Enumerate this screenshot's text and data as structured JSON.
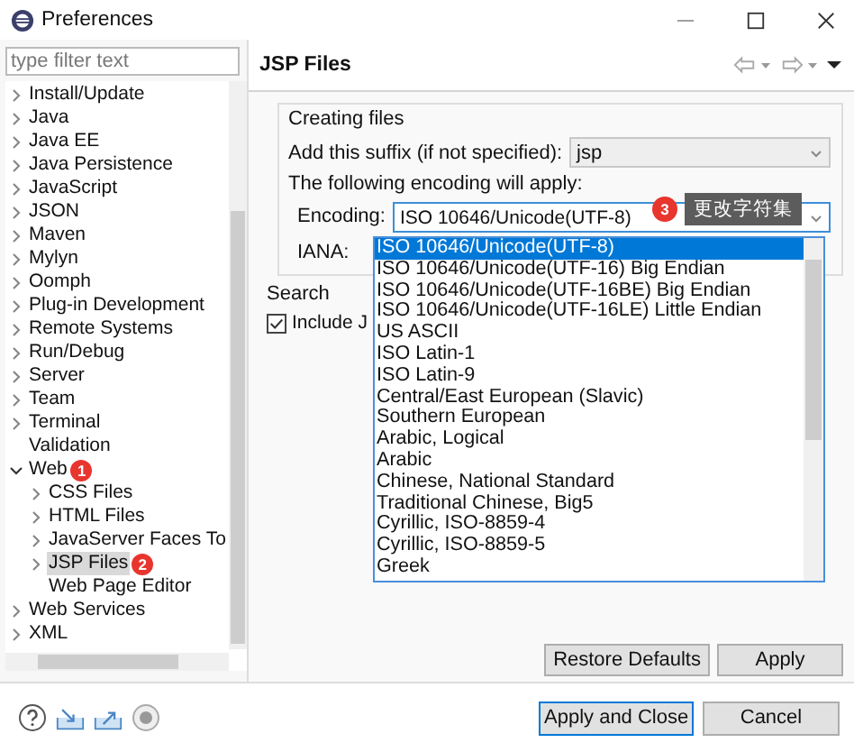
{
  "window": {
    "title": "Preferences"
  },
  "filter": {
    "placeholder": "type filter text"
  },
  "tree": [
    {
      "label": "Install/Update",
      "expanded": false,
      "selected": false
    },
    {
      "label": "Java",
      "expanded": false,
      "selected": false
    },
    {
      "label": "Java EE",
      "expanded": false,
      "selected": false
    },
    {
      "label": "Java Persistence",
      "expanded": false,
      "selected": false
    },
    {
      "label": "JavaScript",
      "expanded": false,
      "selected": false
    },
    {
      "label": "JSON",
      "expanded": false,
      "selected": false
    },
    {
      "label": "Maven",
      "expanded": false,
      "selected": false
    },
    {
      "label": "Mylyn",
      "expanded": false,
      "selected": false
    },
    {
      "label": "Oomph",
      "expanded": false,
      "selected": false
    },
    {
      "label": "Plug-in Development",
      "expanded": false,
      "selected": false
    },
    {
      "label": "Remote Systems",
      "expanded": false,
      "selected": false
    },
    {
      "label": "Run/Debug",
      "expanded": false,
      "selected": false
    },
    {
      "label": "Server",
      "expanded": false,
      "selected": false
    },
    {
      "label": "Team",
      "expanded": false,
      "selected": false
    },
    {
      "label": "Terminal",
      "expanded": false,
      "selected": false
    },
    {
      "label": "Validation",
      "selected": false
    },
    {
      "label": "Web",
      "expanded": true,
      "selected": false,
      "badge": "1",
      "children": [
        {
          "label": "CSS Files",
          "expanded": false,
          "selected": false
        },
        {
          "label": "HTML Files",
          "expanded": false,
          "selected": false
        },
        {
          "label": "JavaServer Faces To",
          "expanded": false,
          "selected": false
        },
        {
          "label": "JSP Files",
          "expanded": false,
          "selected": true,
          "badge": "2"
        },
        {
          "label": "Web Page Editor",
          "selected": false
        }
      ]
    },
    {
      "label": "Web Services",
      "expanded": false,
      "selected": false
    },
    {
      "label": "XML",
      "expanded": false,
      "selected": false
    }
  ],
  "page": {
    "title": "JSP Files",
    "creating_group": {
      "title": "Creating files",
      "suffix_label": "Add this suffix (if not specified):",
      "suffix_value": "jsp",
      "encoding_note": "The following encoding will apply:",
      "encoding_label": "Encoding:",
      "encoding_value": "ISO 10646/Unicode(UTF-8)",
      "iana_label": "IANA:"
    },
    "annotation": {
      "badge": "3",
      "text": "更改字符集"
    },
    "encoding_options": [
      {
        "label": "ISO 10646/Unicode(UTF-8)",
        "selected": true
      },
      {
        "label": "ISO 10646/Unicode(UTF-16) Big Endian",
        "selected": false
      },
      {
        "label": "ISO 10646/Unicode(UTF-16BE) Big Endian",
        "selected": false
      },
      {
        "label": "ISO 10646/Unicode(UTF-16LE) Little Endian",
        "selected": false
      },
      {
        "label": "US ASCII",
        "selected": false
      },
      {
        "label": "ISO Latin-1",
        "selected": false
      },
      {
        "label": "ISO Latin-9",
        "selected": false
      },
      {
        "label": "Central/East European (Slavic)",
        "selected": false
      },
      {
        "label": "Southern European",
        "selected": false
      },
      {
        "label": "Arabic, Logical",
        "selected": false
      },
      {
        "label": "Arabic",
        "selected": false
      },
      {
        "label": "Chinese, National Standard",
        "selected": false
      },
      {
        "label": "Traditional Chinese, Big5",
        "selected": false
      },
      {
        "label": "Cyrillic, ISO-8859-4",
        "selected": false
      },
      {
        "label": "Cyrillic, ISO-8859-5",
        "selected": false
      },
      {
        "label": "Greek",
        "selected": false
      }
    ],
    "search_group": {
      "title": "Search",
      "checkbox_label": "Include J",
      "checked": true
    },
    "buttons": [
      "Restore Defaults",
      "Apply"
    ]
  },
  "footer_buttons": [
    "Apply and Close",
    "Cancel"
  ]
}
